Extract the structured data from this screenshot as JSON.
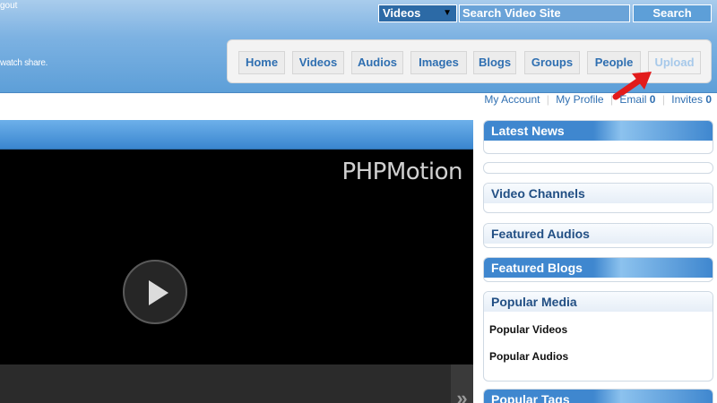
{
  "header": {
    "logout_text": "gout",
    "tagline": "watch share.",
    "search": {
      "category_selected": "Videos",
      "placeholder": "Search Video Site",
      "button_label": "Search"
    },
    "nav": [
      "Home",
      "Videos",
      "Audios",
      "Images",
      "Blogs",
      "Groups",
      "People",
      "Upload"
    ]
  },
  "account_bar": {
    "my_account": "My Account",
    "my_profile": "My Profile",
    "email_label": "Email",
    "email_count": "0",
    "invites_label": "Invites",
    "invites_count": "0"
  },
  "player": {
    "brand": "PHPMotion",
    "next_symbol": "»"
  },
  "sidebar": {
    "latest_news": "Latest News",
    "video_channels": "Video Channels",
    "featured_audios": "Featured Audios",
    "featured_blogs": "Featured Blogs",
    "popular_media": {
      "title": "Popular Media",
      "items": [
        "Popular Videos",
        "Popular Audios"
      ]
    },
    "popular_tags": "Popular Tags"
  },
  "colors": {
    "header_blue": "#5d9fd8",
    "link_blue": "#2f6fb1",
    "annotation_arrow": "#e21b1b"
  },
  "icons": [
    "play-icon",
    "dropdown-caret-icon",
    "annotation-arrow-icon",
    "double-chevron-right-icon"
  ]
}
